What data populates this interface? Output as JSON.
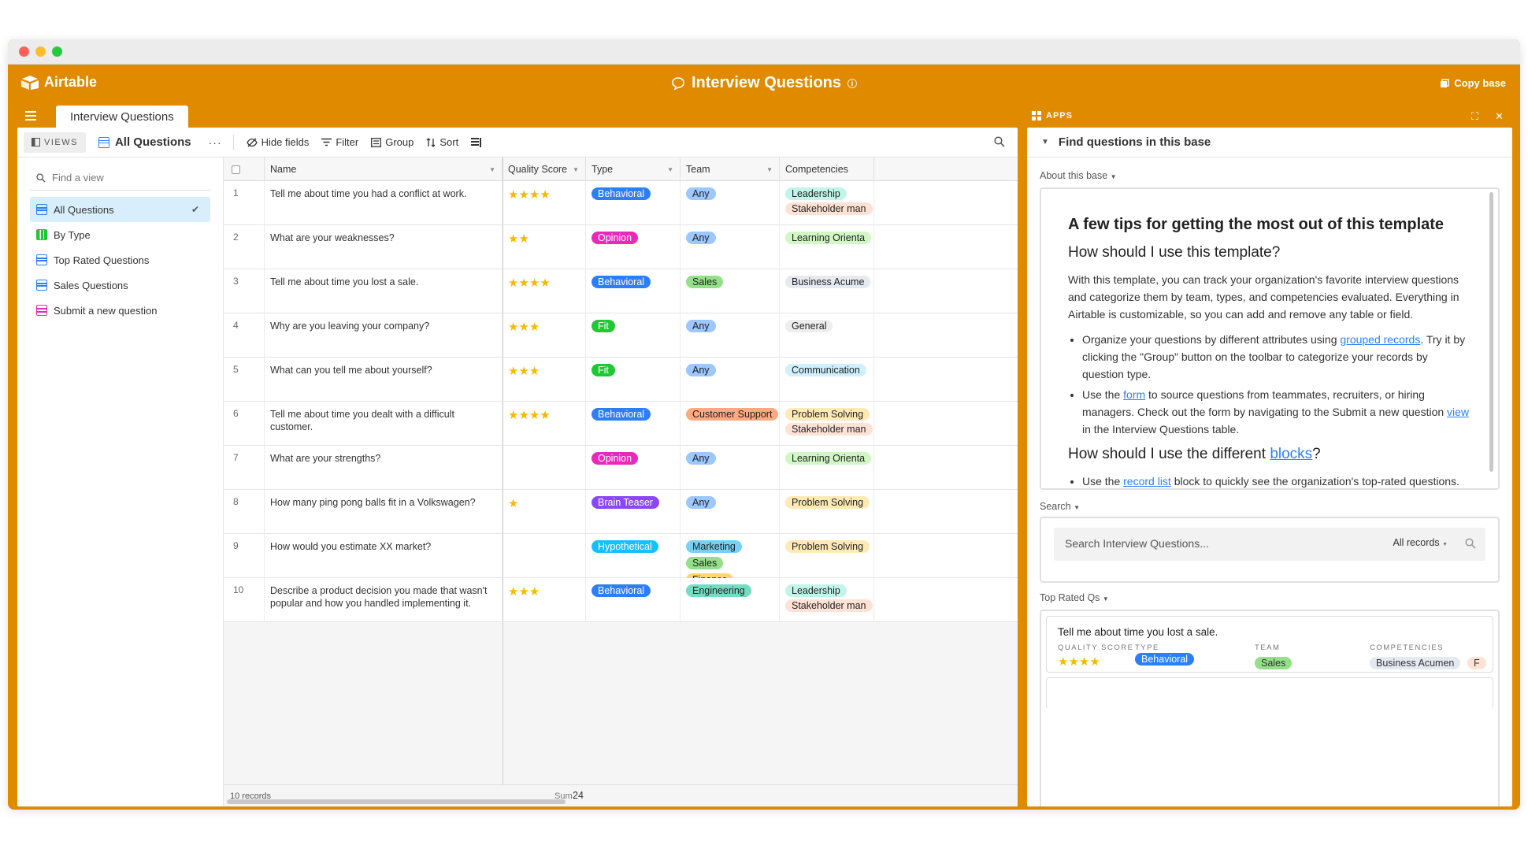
{
  "window": {
    "brand": "Airtable",
    "base_title": "Interview Questions",
    "copy_base": "Copy base"
  },
  "tab": {
    "table_name": "Interview Questions",
    "apps_label": "APPS"
  },
  "viewbar": {
    "views_label": "VIEWS",
    "current_view": "All Questions",
    "more": "···",
    "tools": [
      "Hide fields",
      "Filter",
      "Group",
      "Sort"
    ]
  },
  "sidebar": {
    "find_placeholder": "Find a view",
    "items": [
      {
        "label": "All Questions",
        "kind": "grid",
        "active": true
      },
      {
        "label": "By Type",
        "kind": "kanban"
      },
      {
        "label": "Top Rated Questions",
        "kind": "grid"
      },
      {
        "label": "Sales Questions",
        "kind": "grid"
      },
      {
        "label": "Submit a new question",
        "kind": "form"
      }
    ]
  },
  "grid": {
    "columns": [
      "Name",
      "Quality Score",
      "Type",
      "Team",
      "Competencies"
    ],
    "rows": [
      {
        "num": "1",
        "name": "Tell me about time you had a conflict at work.",
        "stars": "★★★★",
        "type": "Behavioral",
        "team": [
          "Any"
        ],
        "comp": [
          "Leadership",
          "Stakeholder man"
        ]
      },
      {
        "num": "2",
        "name": "What are your weaknesses?",
        "stars": "★★",
        "type": "Opinion",
        "team": [
          "Any"
        ],
        "comp": [
          "Learning Orienta"
        ]
      },
      {
        "num": "3",
        "name": "Tell me about time you lost a sale.",
        "stars": "★★★★",
        "type": "Behavioral",
        "team": [
          "Sales"
        ],
        "comp": [
          "Business Acume"
        ]
      },
      {
        "num": "4",
        "name": "Why are you leaving your company?",
        "stars": "★★★",
        "type": "Fit",
        "team": [
          "Any"
        ],
        "comp": [
          "General"
        ]
      },
      {
        "num": "5",
        "name": "What can you tell me about yourself?",
        "stars": "★★★",
        "type": "Fit",
        "team": [
          "Any"
        ],
        "comp": [
          "Communication"
        ]
      },
      {
        "num": "6",
        "name": "Tell me about time you dealt with a difficult customer.",
        "stars": "★★★★",
        "type": "Behavioral",
        "team": [
          "Customer Support"
        ],
        "comp": [
          "Problem Solving",
          "Stakeholder man"
        ]
      },
      {
        "num": "7",
        "name": "What are your strengths?",
        "stars": "",
        "type": "Opinion",
        "team": [
          "Any"
        ],
        "comp": [
          "Learning Orienta"
        ]
      },
      {
        "num": "8",
        "name": "How many ping pong balls fit in a Volkswagen?",
        "stars": "★",
        "type": "Brain Teaser",
        "team": [
          "Any"
        ],
        "comp": [
          "Problem Solving"
        ]
      },
      {
        "num": "9",
        "name": "How would you estimate XX market?",
        "stars": "",
        "type": "Hypothetical",
        "team": [
          "Marketing",
          "Sales",
          "Finance"
        ],
        "comp": [
          "Problem Solving"
        ]
      },
      {
        "num": "10",
        "name": "Describe a product decision you made that wasn't popular and how you handled implementing it.",
        "stars": "★★★",
        "type": "Behavioral",
        "team": [
          "Engineering"
        ],
        "comp": [
          "Leadership",
          "Stakeholder man"
        ]
      }
    ],
    "footer": {
      "records": "10 records",
      "sum_label": "Sum",
      "sum_value": "24"
    }
  },
  "colors": {
    "Behavioral": "#2d7ff9",
    "Opinion": "#e929ba",
    "Fit": "#20c933",
    "Brain Teaser": "#8b46ff",
    "Hypothetical": "#18bfff",
    "Any": "#9cc7ff",
    "Sales": "#93e088",
    "Customer Support": "#ffa981",
    "Marketing": "#77d1f3",
    "Finance": "#ffd66e",
    "Engineering": "#72ddc3",
    "Leadership": "#c2f5e9",
    "Stakeholder man": "#fee2d5",
    "Learning Orienta": "#d1f7c4",
    "Business Acume": "#e5e9f0",
    "General": "#eeeeee",
    "Communication": "#d0f0fd",
    "Problem Solving": "#ffeab6",
    "brand": "#e08a00"
  },
  "apps": {
    "block_title": "Find questions in this base",
    "about_label": "About this base",
    "doc": {
      "h1": "A few tips for getting the most out of this template",
      "h2a": "How should I use this template?",
      "p1": "With this template, you can track your organization's favorite interview questions and categorize them by team, types, and competencies evaluated. Everything in Airtable is customizable, so you can add and remove any table or field.",
      "b1_pre": "Organize your questions by different attributes using ",
      "b1_link": "grouped records",
      "b1_post": ". Try it by clicking the \"Group\" button on the toolbar to categorize your records by question type.",
      "b2_pre": "Use the ",
      "b2_link": "form",
      "b2_mid": " to source questions from teammates, recruiters, or hiring managers. Check out the form by navigating to the Submit a new question ",
      "b2_link2": "view",
      "b2_post": " in the Interview Questions table.",
      "h2b_pre": "How should I use the different ",
      "h2b_link": "blocks",
      "h2b_post": "?",
      "b3_pre": "Use the ",
      "b3_link": "record list",
      "b3_post": " block to quickly see the organization's top-rated questions."
    },
    "search_label": "Search",
    "search_placeholder": "Search Interview Questions...",
    "search_scope": "All records",
    "top_label": "Top Rated Qs",
    "top_card": {
      "title": "Tell me about time you lost a sale.",
      "quality_label": "QUALITY SCORE",
      "type_label": "TYPE",
      "team_label": "TEAM",
      "comp_label": "COMPETENCIES",
      "stars": "★★★★",
      "type": "Behavioral",
      "team": "Sales",
      "comp": "Business Acumen",
      "comp_more": "F"
    }
  }
}
